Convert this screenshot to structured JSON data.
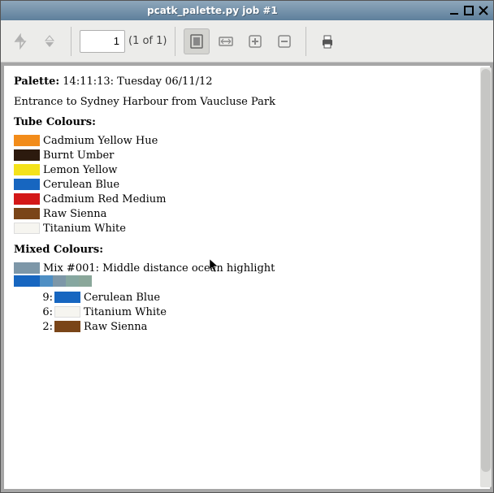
{
  "window": {
    "title": "pcatk_palette.py job #1"
  },
  "toolbar": {
    "page_value": "1",
    "page_of": "(1 of 1)"
  },
  "doc": {
    "header_label": "Palette:",
    "header_value": "14:11:13: Tuesday 06/11/12",
    "description": "Entrance to Sydney Harbour from Vaucluse Park",
    "tube_heading": "Tube Colours:",
    "tube_colours": [
      {
        "name": "Cadmium Yellow Hue",
        "hex": "#f28c1a"
      },
      {
        "name": "Burnt Umber",
        "hex": "#2c1a0e"
      },
      {
        "name": "Lemon Yellow",
        "hex": "#f4e21b"
      },
      {
        "name": "Cerulean Blue",
        "hex": "#1766c0"
      },
      {
        "name": "Cadmium Red Medium",
        "hex": "#d31818"
      },
      {
        "name": "Raw Sienna",
        "hex": "#7a4518"
      },
      {
        "name": "Titanium White",
        "hex": "#f6f5f0"
      }
    ],
    "mixed_heading": "Mixed Colours:",
    "mix": {
      "swatch_hex": "#7d97a8",
      "label": "Mix #001: Middle distance ocean highlight",
      "gradient": [
        {
          "hex": "#1766c0",
          "w": 32
        },
        {
          "hex": "#4f8fc4",
          "w": 16
        },
        {
          "hex": "#7d97a8",
          "w": 16
        },
        {
          "hex": "#86a7a0",
          "w": 16
        },
        {
          "hex": "#8aa79a",
          "w": 16
        }
      ],
      "components": [
        {
          "ratio": "9:",
          "hex": "#1766c0",
          "name": "Cerulean Blue"
        },
        {
          "ratio": "6:",
          "hex": "#f6f5f0",
          "name": "Titanium White"
        },
        {
          "ratio": "2:",
          "hex": "#7a4518",
          "name": "Raw Sienna"
        }
      ]
    }
  }
}
